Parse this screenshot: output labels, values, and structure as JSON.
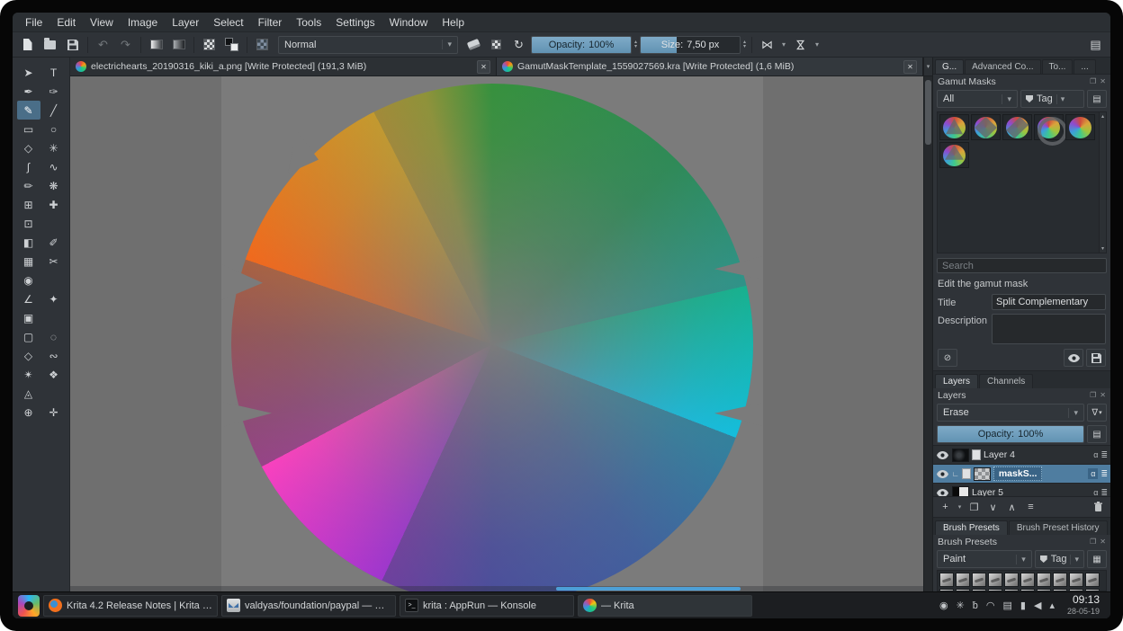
{
  "colors": {
    "accent": "#3daee9",
    "selection": "#4f7da0",
    "slider_fill": "#6d9cbc",
    "canvas_gray": "#7b7b7b"
  },
  "menu": {
    "items": [
      "File",
      "Edit",
      "View",
      "Image",
      "Layer",
      "Select",
      "Filter",
      "Tools",
      "Settings",
      "Window",
      "Help"
    ]
  },
  "toolbar": {
    "blend_mode_value": "Normal",
    "opacity_label": "Opacity:",
    "opacity_value": "100%",
    "size_label": "Size:",
    "size_value": "7,50 px"
  },
  "toolbox": {
    "tools": [
      {
        "name": "select-shapes",
        "glyph": "➤"
      },
      {
        "name": "text",
        "glyph": "T"
      },
      {
        "name": "edit-shapes",
        "glyph": "✒"
      },
      {
        "name": "calligraphy",
        "glyph": "✑"
      },
      {
        "name": "freehand-brush",
        "glyph": "✎",
        "active": true
      },
      {
        "name": "line",
        "glyph": "╱"
      },
      {
        "name": "rectangle",
        "glyph": "▭"
      },
      {
        "name": "ellipse",
        "glyph": "○"
      },
      {
        "name": "polygon",
        "glyph": "◇"
      },
      {
        "name": "polyline",
        "glyph": "✳"
      },
      {
        "name": "bezier-curve",
        "glyph": "∫"
      },
      {
        "name": "freehand-path",
        "glyph": "∿"
      },
      {
        "name": "dynamic-brush",
        "glyph": "✏"
      },
      {
        "name": "multibrush",
        "glyph": "❋"
      },
      {
        "name": "transform",
        "glyph": "⊞"
      },
      {
        "name": "move",
        "glyph": "✚"
      },
      {
        "name": "crop",
        "glyph": "⊡"
      },
      {
        "name": "",
        "glyph": ""
      },
      {
        "name": "gradient",
        "glyph": "◧"
      },
      {
        "name": "color-sampler",
        "glyph": "✐"
      },
      {
        "name": "pattern-edit",
        "glyph": "▦"
      },
      {
        "name": "smart-patch",
        "glyph": "✂"
      },
      {
        "name": "fill",
        "glyph": "◉"
      },
      {
        "name": "",
        "glyph": ""
      },
      {
        "name": "assistants",
        "glyph": "∠"
      },
      {
        "name": "measure",
        "glyph": "✦"
      },
      {
        "name": "reference-images",
        "glyph": "▣"
      },
      {
        "name": "",
        "glyph": ""
      },
      {
        "name": "select-rectangular",
        "glyph": "▢"
      },
      {
        "name": "select-elliptical",
        "glyph": "◌"
      },
      {
        "name": "select-polygonal",
        "glyph": "◇"
      },
      {
        "name": "select-freehand",
        "glyph": "∾"
      },
      {
        "name": "select-similar",
        "glyph": "✴"
      },
      {
        "name": "select-contiguous",
        "glyph": "❖"
      },
      {
        "name": "select-bezier",
        "glyph": "◬"
      },
      {
        "name": "",
        "glyph": ""
      },
      {
        "name": "zoom",
        "glyph": "⊕"
      },
      {
        "name": "pan",
        "glyph": "✛"
      }
    ]
  },
  "document_tabs": [
    {
      "title": "electrichearts_20190316_kiki_a.png [Write Protected]  (191,3 MiB)",
      "active": false
    },
    {
      "title": "GamutMaskTemplate_1559027569.kra [Write Protected]  (1,6 MiB)",
      "active": true
    }
  ],
  "right_panel": {
    "docker_tabs": [
      {
        "label": "G...",
        "active": true
      },
      {
        "label": "Advanced Co...",
        "active": false
      },
      {
        "label": "To...",
        "active": false
      },
      {
        "label": "...",
        "active": false
      }
    ],
    "gamut_masks": {
      "title": "Gamut Masks",
      "filter_value": "All",
      "tag_label": "Tag",
      "thumbs": [
        {
          "name": "gamut-mask-1",
          "variant": "v1"
        },
        {
          "name": "gamut-mask-2",
          "variant": "v2"
        },
        {
          "name": "gamut-mask-3",
          "variant": "v3"
        },
        {
          "name": "gamut-mask-4",
          "variant": "v4"
        },
        {
          "name": "gamut-mask-5",
          "variant": "v5"
        },
        {
          "name": "gamut-mask-6",
          "variant": "v6"
        }
      ],
      "search_placeholder": "Search",
      "edit_section_label": "Edit the gamut mask",
      "title_label": "Title",
      "title_value": "Split Complementary",
      "description_label": "Description",
      "description_value": ""
    },
    "layers": {
      "tab_layers": "Layers",
      "tab_channels": "Channels",
      "title": "Layers",
      "blend_mode_value": "Erase",
      "opacity_label": "Opacity:",
      "opacity_value": "100%",
      "rows": [
        {
          "name": "Layer 4",
          "kind": "paint",
          "selected": false
        },
        {
          "name": "maskS...",
          "kind": "mask",
          "selected": true
        },
        {
          "name": "Layer 5",
          "kind": "split",
          "selected": false
        }
      ]
    },
    "brush_presets": {
      "tab_presets": "Brush Presets",
      "tab_history": "Brush Preset History",
      "title": "Brush Presets",
      "filter_value": "Paint",
      "tag_label": "Tag",
      "cell_count": 20
    }
  },
  "taskbar": {
    "tasks": [
      {
        "label": "Krita 4.2 Release Notes | Krita - ...",
        "icon": "firefox",
        "active": false
      },
      {
        "label": "valdyas/foundation/paypal — KM...",
        "icon": "kmail",
        "active": false
      },
      {
        "label": "krita : AppRun — Konsole",
        "icon": "konsole",
        "active": false
      },
      {
        "label": "— Krita",
        "icon": "krita",
        "active": true
      }
    ],
    "tray_icons": [
      {
        "name": "user",
        "glyph": "◉"
      },
      {
        "name": "settings",
        "glyph": "✳"
      },
      {
        "name": "bluetooth",
        "glyph": "ƀ"
      },
      {
        "name": "wifi",
        "glyph": "◠"
      },
      {
        "name": "calendar",
        "glyph": "▤"
      },
      {
        "name": "battery",
        "glyph": "▮"
      },
      {
        "name": "volume",
        "glyph": "◀"
      },
      {
        "name": "expand",
        "glyph": "▴"
      }
    ],
    "clock_time": "09:13",
    "clock_date": "28-05-19"
  }
}
